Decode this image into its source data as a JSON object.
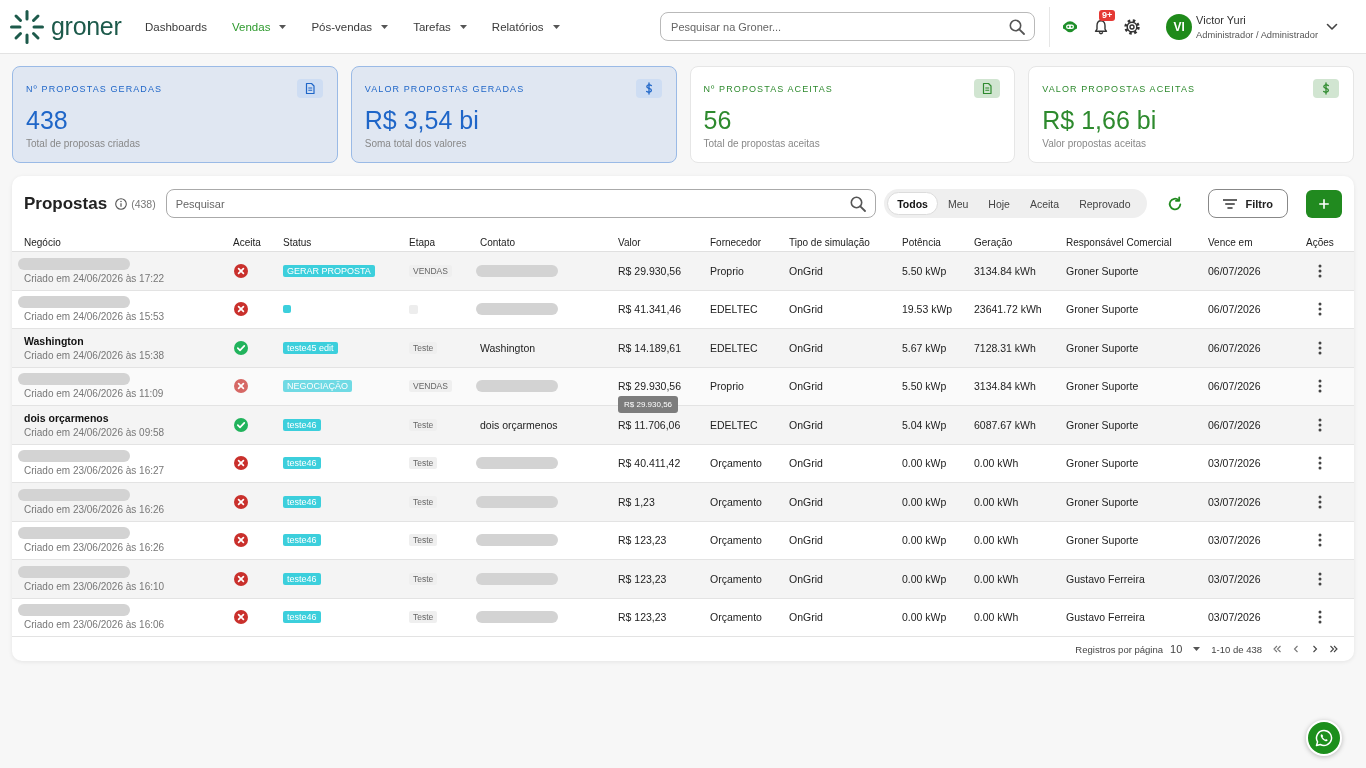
{
  "header": {
    "logo": {
      "name": "groner"
    },
    "nav": [
      {
        "label": "Dashboards",
        "selected": false,
        "dropdown": false
      },
      {
        "label": "Vendas",
        "selected": true,
        "dropdown": true
      },
      {
        "label": "Pós-vendas",
        "selected": false,
        "dropdown": true
      },
      {
        "label": "Tarefas",
        "selected": false,
        "dropdown": true
      },
      {
        "label": "Relatórios",
        "selected": false,
        "dropdown": true
      }
    ],
    "search": {
      "placeholder": "Pesquisar na Groner..."
    },
    "notifications": {
      "badge": "9+"
    },
    "user": {
      "initials": "VI",
      "name": "Victor Yuri",
      "role": "Administrador / Administrador"
    }
  },
  "cards": [
    {
      "kind": "count",
      "label": "Nº PROPOSTAS GERADAS",
      "value": "438",
      "caption": "Total de proposas criadas",
      "color": "#1f66c8",
      "selected": true
    },
    {
      "kind": "amount",
      "label": "VALOR PROPOSTAS GERADAS",
      "value": "R$ 3,54 bi",
      "caption": "Soma total dos valores",
      "color": "#1f66c8",
      "selected": true
    },
    {
      "kind": "count",
      "label": "Nº PROPOSTAS ACEITAS",
      "value": "56",
      "caption": "Total de propostas aceitas",
      "color": "#2e8a2e",
      "selected": false
    },
    {
      "kind": "amount",
      "label": "VALOR PROPOSTAS ACEITAS",
      "value": "R$ 1,66 bi",
      "caption": "Valor propostas aceitas",
      "color": "#2e8a2e",
      "selected": false
    }
  ],
  "proposals": {
    "title": "Propostas",
    "count": "(438)",
    "search": {
      "placeholder": "Pesquisar"
    },
    "filters": [
      {
        "label": "Todos",
        "selected": true
      },
      {
        "label": "Meu",
        "selected": false
      },
      {
        "label": "Hoje",
        "selected": false
      },
      {
        "label": "Aceita",
        "selected": false
      },
      {
        "label": "Reprovado",
        "selected": false
      }
    ],
    "filter_button": "Filtro",
    "table": {
      "columns": [
        "Negócio",
        "Aceita",
        "Status",
        "Etapa",
        "Contato",
        "Valor",
        "Fornecedor",
        "Tipo de simulação",
        "Potência",
        "Geração",
        "Responsável Comercial",
        "Vence em",
        "Ações"
      ],
      "rows": [
        {
          "name_redacted": true,
          "created": "Criado em 24/06/2026 às 17:22",
          "accepted": false,
          "hovered": false,
          "status": {
            "kind": "badge",
            "text": "GERAR PROPOSTA"
          },
          "stage": {
            "kind": "badge",
            "text": "VENDAS"
          },
          "contact_redacted": true,
          "value": "R$ 29.930,56",
          "supplier": "Proprio",
          "simulation": "OnGrid",
          "power": "5.50 kWp",
          "generation": "3134.84 kWh",
          "owner": "Groner Suporte",
          "due": "06/07/2026"
        },
        {
          "name_redacted": true,
          "created": "Criado em 24/06/2026 às 15:53",
          "accepted": false,
          "hovered": false,
          "status": {
            "kind": "empty"
          },
          "stage": {
            "kind": "empty"
          },
          "contact_redacted": true,
          "value": "R$ 41.341,46",
          "supplier": "EDELTEC",
          "simulation": "OnGrid",
          "power": "19.53 kWp",
          "generation": "23641.72 kWh",
          "owner": "Groner Suporte",
          "due": "06/07/2026"
        },
        {
          "name_redacted": false,
          "name": "Washington",
          "created": "Criado em 24/06/2026 às 15:38",
          "accepted": true,
          "hovered": false,
          "status": {
            "kind": "badge",
            "text": "teste45 edit"
          },
          "stage": {
            "kind": "badge",
            "text": "Teste"
          },
          "contact_redacted": false,
          "contact": "Washington",
          "value": "R$ 14.189,61",
          "supplier": "EDELTEC",
          "simulation": "OnGrid",
          "power": "5.67 kWp",
          "generation": "7128.31 kWh",
          "owner": "Groner Suporte",
          "due": "06/07/2026"
        },
        {
          "name_redacted": true,
          "created": "Criado em 24/06/2026 às 11:09",
          "accepted": false,
          "hovered": true,
          "status": {
            "kind": "badge",
            "text": "NEGOCIAÇÃO"
          },
          "stage": {
            "kind": "badge",
            "text": "VENDAS"
          },
          "contact_redacted": true,
          "value": "R$ 29.930,56",
          "tooltip": "R$ 29.930,56",
          "supplier": "Proprio",
          "simulation": "OnGrid",
          "power": "5.50 kWp",
          "generation": "3134.84 kWh",
          "owner": "Groner Suporte",
          "due": "06/07/2026"
        },
        {
          "name_redacted": false,
          "name": "dois orçarmenos",
          "created": "Criado em 24/06/2026 às 09:58",
          "accepted": true,
          "hovered": false,
          "status": {
            "kind": "badge",
            "text": "teste46"
          },
          "stage": {
            "kind": "badge",
            "text": "Teste"
          },
          "contact_redacted": false,
          "contact": "dois orçarmenos",
          "value": "R$ 11.706,06",
          "supplier": "EDELTEC",
          "simulation": "OnGrid",
          "power": "5.04 kWp",
          "generation": "6087.67 kWh",
          "owner": "Groner Suporte",
          "due": "06/07/2026"
        },
        {
          "name_redacted": true,
          "created": "Criado em 23/06/2026 às 16:27",
          "accepted": false,
          "hovered": false,
          "status": {
            "kind": "badge",
            "text": "teste46"
          },
          "stage": {
            "kind": "badge",
            "text": "Teste"
          },
          "contact_redacted": true,
          "value": "R$ 40.411,42",
          "supplier": "Orçamento",
          "simulation": "OnGrid",
          "power": "0.00 kWp",
          "generation": "0.00 kWh",
          "owner": "Groner Suporte",
          "due": "03/07/2026"
        },
        {
          "name_redacted": true,
          "created": "Criado em 23/06/2026 às 16:26",
          "accepted": false,
          "hovered": false,
          "status": {
            "kind": "badge",
            "text": "teste46"
          },
          "stage": {
            "kind": "badge",
            "text": "Teste"
          },
          "contact_redacted": true,
          "value": "R$ 1,23",
          "supplier": "Orçamento",
          "simulation": "OnGrid",
          "power": "0.00 kWp",
          "generation": "0.00 kWh",
          "owner": "Groner Suporte",
          "due": "03/07/2026"
        },
        {
          "name_redacted": true,
          "created": "Criado em 23/06/2026 às 16:26",
          "accepted": false,
          "hovered": false,
          "status": {
            "kind": "badge",
            "text": "teste46"
          },
          "stage": {
            "kind": "badge",
            "text": "Teste"
          },
          "contact_redacted": true,
          "value": "R$ 123,23",
          "supplier": "Orçamento",
          "simulation": "OnGrid",
          "power": "0.00 kWp",
          "generation": "0.00 kWh",
          "owner": "Groner Suporte",
          "due": "03/07/2026"
        },
        {
          "name_redacted": true,
          "created": "Criado em 23/06/2026 às 16:10",
          "accepted": false,
          "hovered": false,
          "status": {
            "kind": "badge",
            "text": "teste46"
          },
          "stage": {
            "kind": "badge",
            "text": "Teste"
          },
          "contact_redacted": true,
          "value": "R$ 123,23",
          "supplier": "Orçamento",
          "simulation": "OnGrid",
          "power": "0.00 kWp",
          "generation": "0.00 kWh",
          "owner": "Gustavo Ferreira",
          "due": "03/07/2026"
        },
        {
          "name_redacted": true,
          "created": "Criado em 23/06/2026 às 16:06",
          "accepted": false,
          "hovered": false,
          "status": {
            "kind": "badge",
            "text": "teste46"
          },
          "stage": {
            "kind": "badge",
            "text": "Teste"
          },
          "contact_redacted": true,
          "value": "R$ 123,23",
          "supplier": "Orçamento",
          "simulation": "OnGrid",
          "power": "0.00 kWp",
          "generation": "0.00 kWh",
          "owner": "Gustavo Ferreira",
          "due": "03/07/2026"
        }
      ]
    },
    "pagination": {
      "label": "Registros por página",
      "page_size": "10",
      "range": "1-10 de 438"
    }
  }
}
